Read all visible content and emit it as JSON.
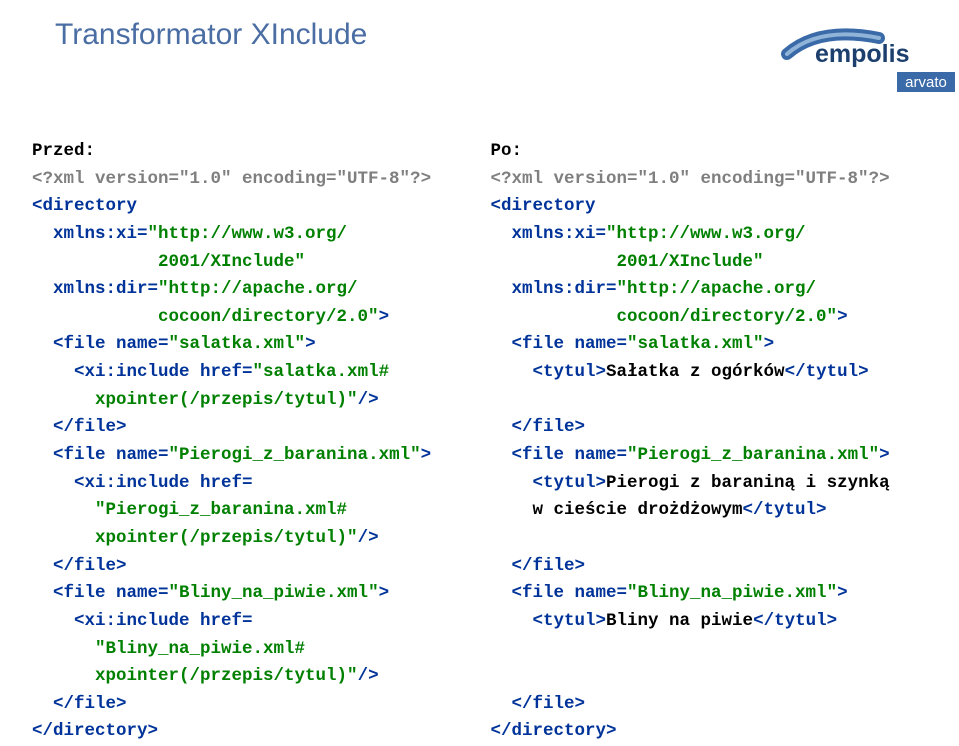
{
  "title": "Transformator XInclude",
  "logo": {
    "main": "empolis",
    "sub": "arvato"
  },
  "left": {
    "header": "Przed:",
    "l01": "<?xml version=\"1.0\" encoding=\"UTF-8\"?>",
    "l02a": "<directory",
    "l03a": "  xmlns:xi=",
    "l03b": "\"http://www.w3.org/",
    "l04": "            2001/XInclude\"",
    "l05a": "  xmlns:dir=",
    "l05b": "\"http://apache.org/",
    "l06": "            cocoon/directory/2.0\"",
    "l06b": ">",
    "l07a": "  <file name=",
    "l07b": "\"salatka.xml\"",
    "l07c": ">",
    "l08a": "    <xi:include href=",
    "l08b": "\"salatka.xml#",
    "l09": "      xpointer(/przepis/tytul)\"",
    "l09b": "/>",
    "l10": "  </file>",
    "l11a": "  <file name=",
    "l11b": "\"Pierogi_z_baranina.xml\"",
    "l11c": ">",
    "l12a": "    <xi:include href=",
    "l13": "      \"Pierogi_z_baranina.xml#",
    "l14": "      xpointer(/przepis/tytul)\"",
    "l14b": "/>",
    "l15": "  </file>",
    "l16a": "  <file name=",
    "l16b": "\"Bliny_na_piwie.xml\"",
    "l16c": ">",
    "l17a": "    <xi:include href=",
    "l18": "      \"Bliny_na_piwie.xml#",
    "l19": "      xpointer(/przepis/tytul)\"",
    "l19b": "/>",
    "l20": "  </file>",
    "l21": "</directory>"
  },
  "right": {
    "header": "Po:",
    "l01": "<?xml version=\"1.0\" encoding=\"UTF-8\"?>",
    "l02a": "<directory",
    "l03a": "  xmlns:xi=",
    "l03b": "\"http://www.w3.org/",
    "l04": "            2001/XInclude\"",
    "l05a": "  xmlns:dir=",
    "l05b": "\"http://apache.org/",
    "l06": "            cocoon/directory/2.0\"",
    "l06b": ">",
    "l07a": "  <file name=",
    "l07b": "\"salatka.xml\"",
    "l07c": ">",
    "l08a": "    <tytul>",
    "l08b": "Sałatka z ogórków",
    "l08c": "</tytul>",
    "l09": "",
    "l10": "  </file>",
    "l11a": "  <file name=",
    "l11b": "\"Pierogi_z_baranina.xml\"",
    "l11c": ">",
    "l12a": "    <tytul>",
    "l12b": "Pierogi z baraniną i szynką",
    "l13": "    w cieście drożdżowym",
    "l13b": "</tytul>",
    "l14": "",
    "l15": "  </file>",
    "l16a": "  <file name=",
    "l16b": "\"Bliny_na_piwie.xml\"",
    "l16c": ">",
    "l17a": "    <tytul>",
    "l17b": "Bliny na piwie",
    "l17c": "</tytul>",
    "l18": "",
    "l19": "",
    "l20": "  </file>",
    "l21": "</directory>"
  }
}
